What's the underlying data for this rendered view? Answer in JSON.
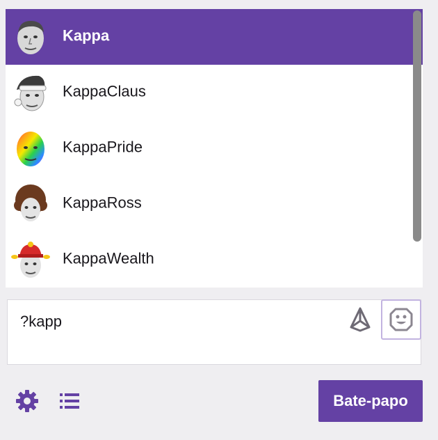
{
  "emote_suggestions": [
    {
      "name": "Kappa",
      "icon": "kappa-face-icon",
      "selected": true
    },
    {
      "name": "KappaClaus",
      "icon": "kappaclaus-face-icon",
      "selected": false
    },
    {
      "name": "KappaPride",
      "icon": "kappapride-face-icon",
      "selected": false
    },
    {
      "name": "KappaRoss",
      "icon": "kappaross-face-icon",
      "selected": false
    },
    {
      "name": "KappaWealth",
      "icon": "kappawealth-face-icon",
      "selected": false
    }
  ],
  "chat_input": {
    "value": "?kapp"
  },
  "icons": {
    "bits": "bits-icon",
    "emote_picker": "smiley-icon",
    "settings": "gear-icon",
    "viewer_list": "list-icon"
  },
  "chat_button": {
    "label": "Bate-papo"
  },
  "colors": {
    "accent": "#6441a4",
    "background": "#efeef1",
    "text": "#19171c"
  }
}
